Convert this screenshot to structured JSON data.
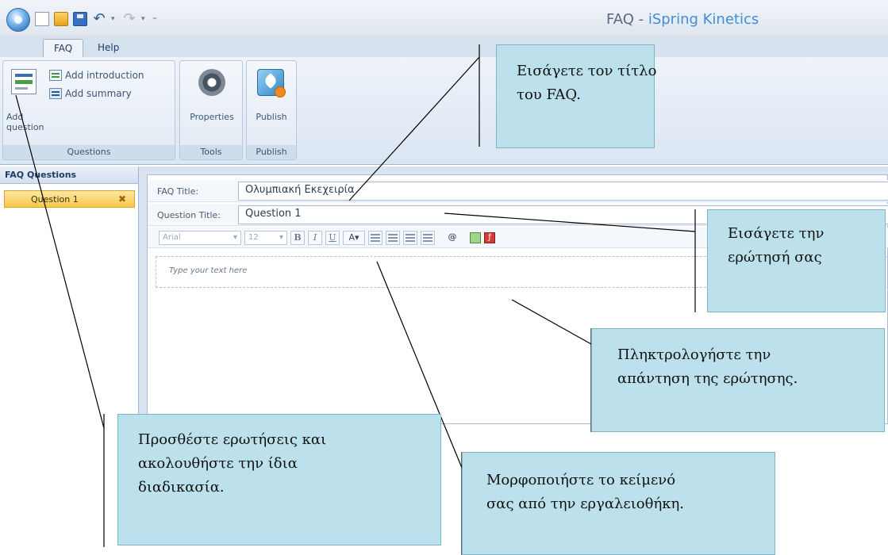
{
  "titlebar": {
    "title_prefix": "FAQ - ",
    "title_brand": "iSpring Kinetics",
    "quick_access": [
      "new-icon",
      "open-folder-icon",
      "save-icon",
      "undo-icon",
      "redo-icon",
      "customize-icon"
    ]
  },
  "ribbon": {
    "tabs": [
      {
        "label": "FAQ",
        "active": true
      },
      {
        "label": "Help",
        "active": false
      }
    ],
    "groups": {
      "questions": {
        "label": "Questions",
        "add_question_line1": "Add",
        "add_question_line2": "question",
        "add_introduction": "Add introduction",
        "add_summary": "Add summary"
      },
      "tools": {
        "label": "Tools",
        "properties": "Properties"
      },
      "publish": {
        "label": "Publish",
        "publish": "Publish"
      }
    }
  },
  "sidebar": {
    "header": "FAQ Questions",
    "items": [
      {
        "label": "Question 1",
        "remove_symbol": "✖"
      }
    ]
  },
  "editor": {
    "faq_title_label": "FAQ Title:",
    "faq_title_value": "Ολυμπιακή Εκεχειρία",
    "question_title_label": "Question Title:",
    "question_title_value": "Question 1",
    "toolbar": {
      "font_family": "Arial",
      "font_size": "12",
      "bold": "B",
      "italic": "I",
      "underline": "U",
      "font_color": "A"
    },
    "answer_placeholder": "Type your text here"
  },
  "callouts": {
    "faq_title": [
      "Εισάγετε τον τίτλο",
      "του FAQ."
    ],
    "question": [
      "Εισάγετε την",
      "ερώτησή σας"
    ],
    "answer": [
      "Πληκτρολογήστε την",
      "απάντηση της ερώτησης."
    ],
    "add_questions": [
      "Προσθέστε ερωτήσεις και",
      "ακολουθήστε την ίδια",
      "διαδικασία."
    ],
    "format_text": [
      "Μορφοποιήστε το κείμενό",
      "σας από την εργαλειοθήκη."
    ]
  },
  "colors": {
    "callout_fill": "#bde1ec",
    "brand_accent": "#3f8fd6",
    "selected_item": "#f7c948"
  }
}
